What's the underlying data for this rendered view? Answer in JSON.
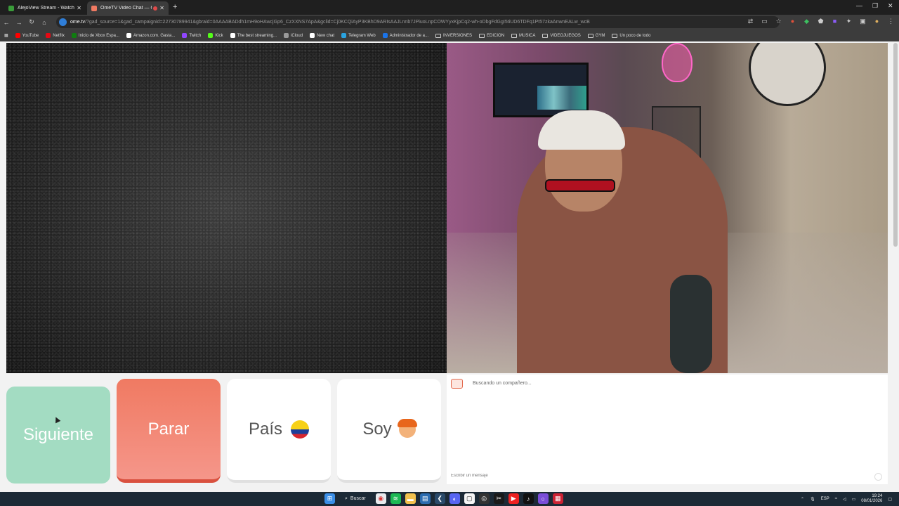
{
  "browser": {
    "tabs": [
      {
        "title": "AlejoView Stream - Watch Live",
        "favicon_color": "#3a9c3a",
        "active": false
      },
      {
        "title": "OmeTV Video Chat — Ome",
        "favicon_color": "#f07a62",
        "active": true
      }
    ],
    "new_tab_icon": "plus-icon",
    "url": {
      "host": "ome.tv",
      "path": "/?gad_source=1&gad_campaignid=22730789941&gbraid=0AAAABADdh1mH9oHAwcjGp6_CzXXNS7ApA&gclid=Cj0KCQiAyP3KBhD9ARIsAAJLnnb7JPiuoLnpCOWYyxKjpCq2-wh-oDbgFdGgI5tiUD6TDFq1Pt57zkaAnwnEALw_wcB"
    },
    "bookmarks": [
      {
        "label": "YouTube",
        "color": "#ff0000"
      },
      {
        "label": "Netflix",
        "color": "#e50914"
      },
      {
        "label": "Inicio de Xbox Espa...",
        "color": "#107c10"
      },
      {
        "label": "Amazon.com. Gasta...",
        "color": "#ffffff"
      },
      {
        "label": "Twitch",
        "color": "#9146ff"
      },
      {
        "label": "Kick",
        "color": "#53fc18"
      },
      {
        "label": "The best streaming...",
        "color": "#ffffff"
      },
      {
        "label": "iCloud",
        "color": "#9a9a9a"
      },
      {
        "label": "New chat",
        "color": "#ffffff"
      },
      {
        "label": "Telegram Web",
        "color": "#2aa3e0"
      },
      {
        "label": "Administrador de a...",
        "color": "#1a73e8"
      }
    ],
    "bookmark_folders": [
      "INVERSIONES",
      "EDICION",
      "MUSICA",
      "VIDEOJUEGOS",
      "GYM",
      "Un poco de todo"
    ]
  },
  "controls": {
    "next_label": "Siguiente",
    "stop_label": "Parar",
    "country_label": "País",
    "country_flag": "colombia-flag-icon",
    "gender_label": "Soy",
    "gender_icon": "boy-face-icon",
    "colors": {
      "next": "#a3dcc2",
      "stop": "#f07a62",
      "neutral": "#ffffff"
    }
  },
  "chat": {
    "status": "Buscando un compañero...",
    "input_placeholder": "Escribir un mensaje"
  },
  "taskbar": {
    "search_label": "Buscar",
    "language": "ESP",
    "time": "19:24",
    "date": "08/01/2026"
  }
}
